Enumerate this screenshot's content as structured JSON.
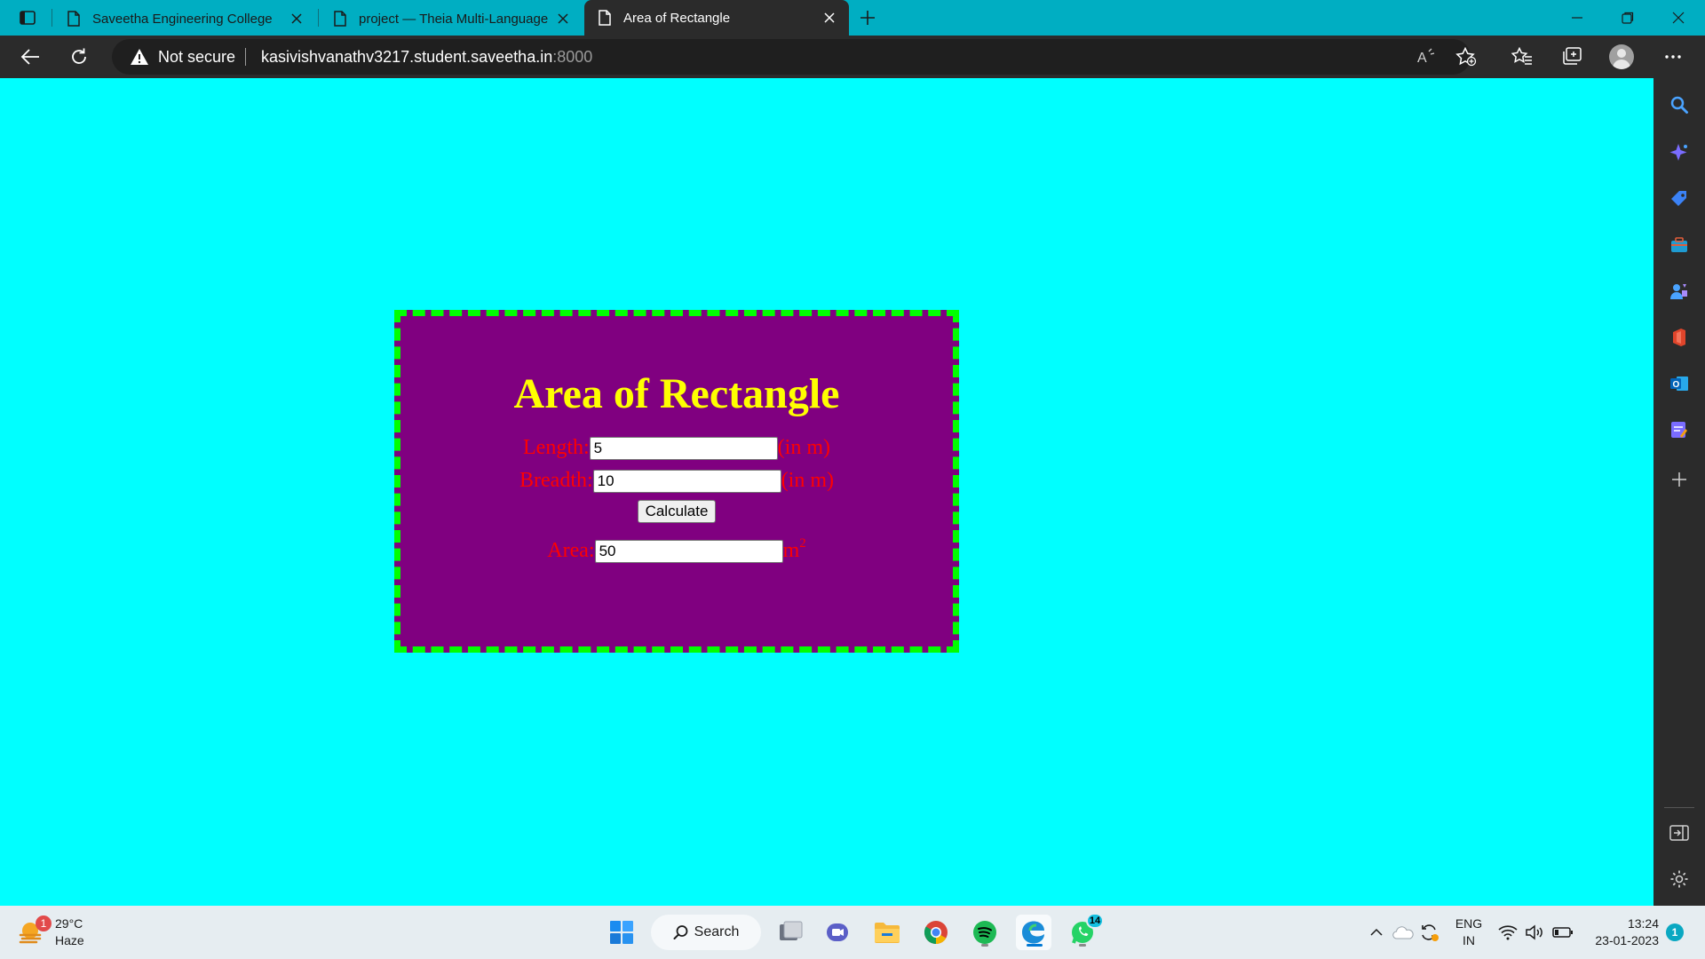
{
  "browser": {
    "tabs": [
      {
        "title": "Saveetha Engineering College",
        "active": false
      },
      {
        "title": "project — Theia Multi-Language",
        "active": false
      },
      {
        "title": "Area of Rectangle",
        "active": true
      }
    ],
    "security_label": "Not secure",
    "url_host": "kasivishvanathv3217.student.saveetha.in",
    "url_port": ":8000"
  },
  "page": {
    "heading": "Area of Rectangle",
    "length_label": "Length:",
    "length_value": "5",
    "length_unit": "(in m)",
    "breadth_label": "Breadth:",
    "breadth_value": "10",
    "breadth_unit": "(in m)",
    "calculate_label": "Calculate",
    "area_label": "Area:",
    "area_value": "50",
    "area_unit": "m",
    "area_unit_power": "2",
    "colors": {
      "background": "#00ffff",
      "card": "#800080",
      "border": "#00ff00",
      "heading": "#ffff00",
      "labels": "#ff0000"
    }
  },
  "taskbar": {
    "weather_badge": "1",
    "temperature": "29°C",
    "condition": "Haze",
    "search_label": "Search",
    "whatsapp_badge": "14",
    "lang_top": "ENG",
    "lang_bottom": "IN",
    "time": "13:24",
    "date": "23-01-2023",
    "notification_count": "1"
  }
}
